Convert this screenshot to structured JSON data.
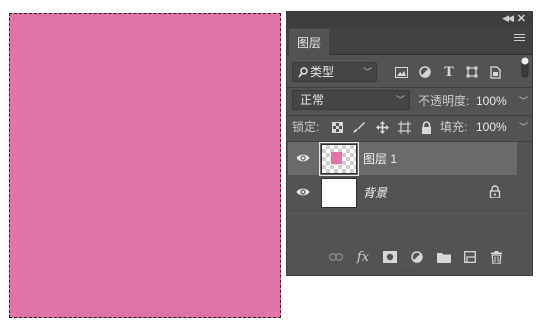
{
  "colors": {
    "canvas_fill": "#e074a9",
    "panel_bg": "#535353",
    "selected_row": "#6a6a6a"
  },
  "panel": {
    "tab_label": "图层",
    "filter": {
      "label": "类型",
      "search_icon": "search-icon"
    },
    "blend_mode": "正常",
    "opacity_label": "不透明度:",
    "opacity_value": "100%",
    "lock_label": "锁定:",
    "fill_label": "填充:",
    "fill_value": "100%",
    "filter_icons": [
      "image-filter-icon",
      "adjustment-filter-icon",
      "type-filter-icon",
      "shape-filter-icon",
      "smart-object-filter-icon"
    ],
    "lock_icons": [
      "lock-transparent-pixels-icon",
      "lock-image-pixels-icon",
      "lock-position-icon",
      "lock-artboard-icon",
      "lock-all-icon"
    ],
    "fx_label": "fx"
  },
  "layers": [
    {
      "name": "图层 1",
      "visible": true,
      "selected": true,
      "locked": false
    },
    {
      "name": "背景",
      "visible": true,
      "selected": false,
      "locked": true
    }
  ]
}
